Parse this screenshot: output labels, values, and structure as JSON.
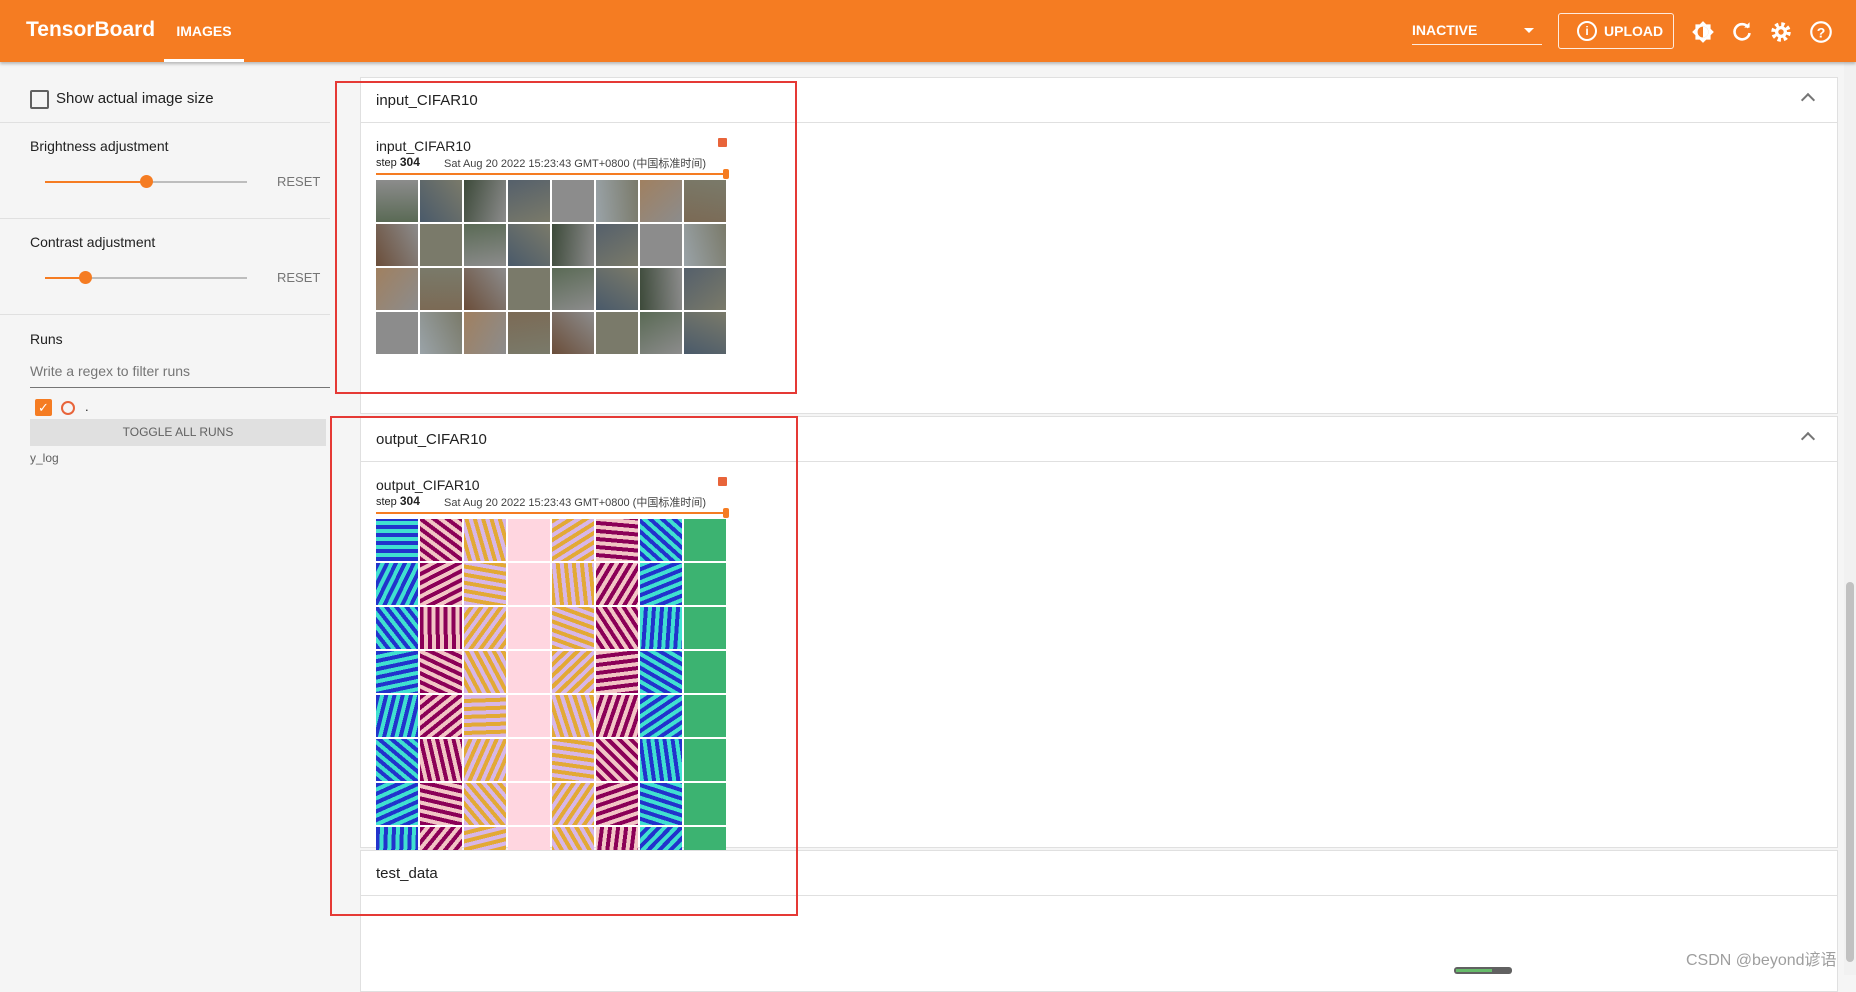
{
  "app": {
    "title": "TensorBoard",
    "active_tab": "IMAGES",
    "status": "INACTIVE",
    "upload_label": "UPLOAD"
  },
  "toolbar_icons": [
    "theme-icon",
    "refresh-icon",
    "settings-icon",
    "help-icon"
  ],
  "colors": {
    "accent": "#f57c22",
    "run_color": "#e8643a",
    "highlight": "#e53935"
  },
  "sidebar": {
    "show_actual_size_label": "Show actual image size",
    "brightness": {
      "label": "Brightness adjustment",
      "value": 0.5,
      "reset_label": "RESET"
    },
    "contrast": {
      "label": "Contrast adjustment",
      "value": 0.2,
      "reset_label": "RESET"
    },
    "runs": {
      "title": "Runs",
      "filter_placeholder": "Write a regex to filter runs",
      "items": [
        {
          "name": ".",
          "checked": true
        }
      ],
      "toggle_all_label": "TOGGLE ALL RUNS",
      "tag_text": "y_log"
    }
  },
  "panels": [
    {
      "title": "input_CIFAR10",
      "card": {
        "title": "input_CIFAR10",
        "step_label": "step",
        "step": "304",
        "wall_time": "Sat Aug 20 2022 15:23:43 GMT+0800 (中国标准时间)",
        "step_progress": 1.0
      },
      "grid": {
        "rows": 4,
        "cols": 8
      }
    },
    {
      "title": "output_CIFAR10",
      "card": {
        "title": "output_CIFAR10",
        "step_label": "step",
        "step": "304",
        "wall_time": "Sat Aug 20 2022 15:23:43 GMT+0800 (中国标准时间)",
        "step_progress": 1.0
      },
      "grid": {
        "rows": 8,
        "cols": 8
      }
    },
    {
      "title": "test_data"
    }
  ],
  "watermark": "CSDN @beyond谚语"
}
